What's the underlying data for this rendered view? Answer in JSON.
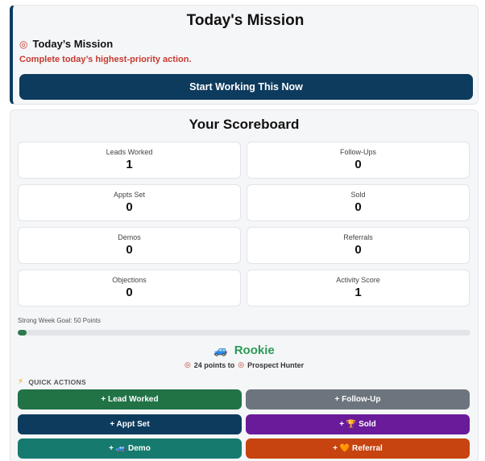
{
  "mission": {
    "title": "Today's Mission",
    "subtitle": "Today’s Mission",
    "description": "Complete today’s highest-priority action.",
    "cta_label": "Start Working This Now"
  },
  "scoreboard": {
    "title": "Your Scoreboard",
    "stats": [
      {
        "label": "Leads Worked",
        "value": "1"
      },
      {
        "label": "Follow-Ups",
        "value": "0"
      },
      {
        "label": "Appts Set",
        "value": "0"
      },
      {
        "label": "Sold",
        "value": "0"
      },
      {
        "label": "Demos",
        "value": "0"
      },
      {
        "label": "Referrals",
        "value": "0"
      },
      {
        "label": "Objections",
        "value": "0"
      },
      {
        "label": "Activity Score",
        "value": "1"
      }
    ],
    "goal_label": "Strong Week Goal: 50 Points",
    "goal_progress_percent": 2,
    "rank": "Rookie",
    "points_text": "24 points to",
    "next_rank": "Prospect Hunter"
  },
  "quick_actions": {
    "label": "QUICK ACTIONS",
    "buttons": [
      {
        "label": "+ Lead Worked",
        "color": "#217346"
      },
      {
        "label": "+ Follow-Up",
        "color": "#6c757d"
      },
      {
        "label": "+ Appt Set",
        "color": "#0d3b5e"
      },
      {
        "label": "+ 🏆 Sold",
        "color": "#6a1b9a"
      },
      {
        "label": "+ 🚙 Demo",
        "color": "#167a6e"
      },
      {
        "label": "+ 🧡 Referral",
        "color": "#c7430f"
      }
    ]
  },
  "colors": {
    "navy": "#0d3b5e",
    "alert_red": "#c63a2f",
    "rank_green": "#2a9a54"
  }
}
